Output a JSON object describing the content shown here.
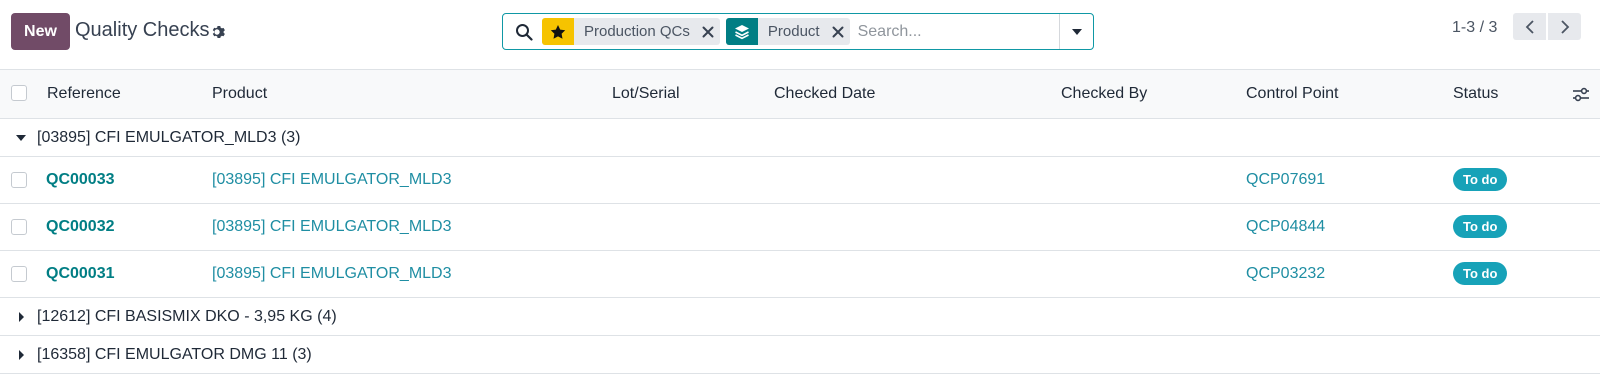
{
  "control_panel": {
    "new_label": "New",
    "title": "Quality Checks",
    "settings_icon": "gear-icon",
    "search": {
      "facets": [
        {
          "label": "Production QCs",
          "icon": "star-icon",
          "color": "#f6c300"
        },
        {
          "label": "Product",
          "icon": "layers-icon",
          "color": "#017e84"
        }
      ],
      "placeholder": "Search..."
    },
    "pager": {
      "text": "1-3 / 3"
    }
  },
  "table": {
    "columns": [
      "Reference",
      "Product",
      "Lot/Serial",
      "Checked Date",
      "Checked By",
      "Control Point",
      "Status"
    ],
    "groups": [
      {
        "label": "[03895] CFI EMULGATOR_MLD3 (3)",
        "expanded": true,
        "rows": [
          {
            "reference": "QC00033",
            "product": "[03895] CFI EMULGATOR_MLD3",
            "lot": "",
            "checked_date": "",
            "checked_by": "",
            "control_point": "QCP07691",
            "status": "To do"
          },
          {
            "reference": "QC00032",
            "product": "[03895] CFI EMULGATOR_MLD3",
            "lot": "",
            "checked_date": "",
            "checked_by": "",
            "control_point": "QCP04844",
            "status": "To do"
          },
          {
            "reference": "QC00031",
            "product": "[03895] CFI EMULGATOR_MLD3",
            "lot": "",
            "checked_date": "",
            "checked_by": "",
            "control_point": "QCP03232",
            "status": "To do"
          }
        ]
      },
      {
        "label": "[12612] CFI BASISMIX DKO - 3,95 KG (4)",
        "expanded": false,
        "rows": []
      },
      {
        "label": "[16358] CFI EMULGATOR DMG 11 (3)",
        "expanded": false,
        "rows": []
      }
    ]
  },
  "colors": {
    "brand": "#714B67",
    "link": "#1f8ea3",
    "status_todo": "#17a2b8"
  }
}
